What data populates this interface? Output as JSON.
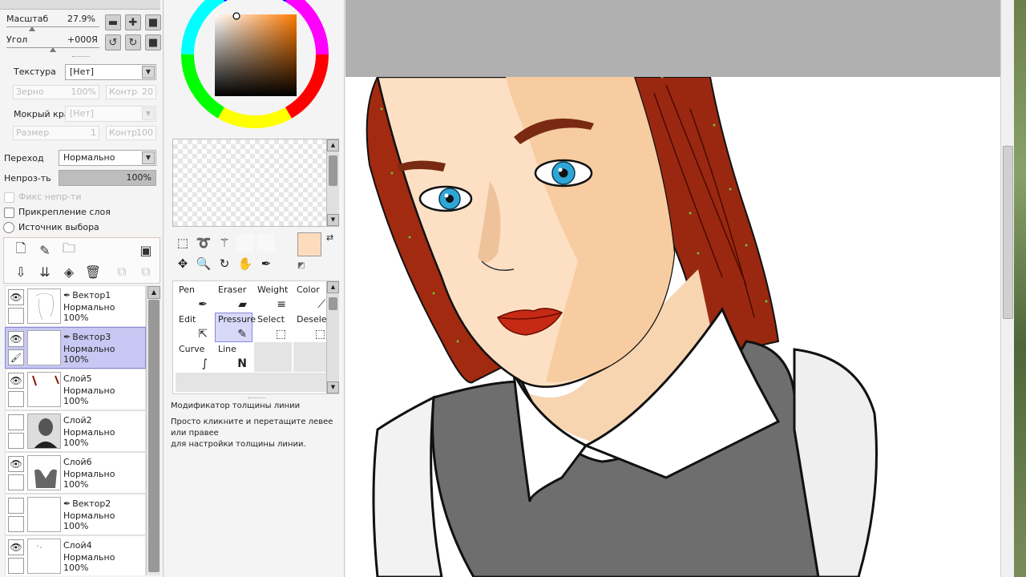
{
  "brush": {
    "zoom_label": "Масштаб",
    "zoom_value": "27.9%",
    "angle_label": "Угол",
    "angle_value": "+000Я",
    "texture_label": "Текстура",
    "texture_value": "[Нет]",
    "grain_label": "Зерно",
    "grain_value": "100%",
    "contrast_label": "Контр",
    "contrast_value": "20",
    "wet_edge_label": "Мокрый край",
    "wet_edge_value": "[Нет]",
    "size_label": "Размер",
    "size_value": "1",
    "contrast2_label": "Контр",
    "contrast2_value": "100"
  },
  "layer_props": {
    "blend_label": "Переход",
    "blend_value": "Нормально",
    "opacity_label": "Непроз-ть",
    "opacity_value": "100%",
    "opacity_level": 1.0,
    "preserve_opacity_label": "Фикс непр-ти",
    "clipping_label": "Прикрепление слоя",
    "selection_source_label": "Источник выбора"
  },
  "layers": [
    {
      "name": "Вектор1",
      "mode": "Нормально",
      "opacity": "100%",
      "vector": true,
      "visible": true,
      "selected": false
    },
    {
      "name": "Вектор3",
      "mode": "Нормально",
      "opacity": "100%",
      "vector": true,
      "visible": true,
      "selected": true
    },
    {
      "name": "Слой5",
      "mode": "Нормально",
      "opacity": "100%",
      "vector": false,
      "visible": true,
      "selected": false
    },
    {
      "name": "Слой2",
      "mode": "Нормально",
      "opacity": "100%",
      "vector": false,
      "visible": false,
      "selected": false
    },
    {
      "name": "Слой6",
      "mode": "Нормально",
      "opacity": "100%",
      "vector": false,
      "visible": true,
      "selected": false
    },
    {
      "name": "Вектор2",
      "mode": "Нормально",
      "opacity": "100%",
      "vector": true,
      "visible": false,
      "selected": false
    },
    {
      "name": "Слой4",
      "mode": "Нормально",
      "opacity": "100%",
      "vector": false,
      "visible": true,
      "selected": false
    }
  ],
  "vector_tools": [
    {
      "label": "Pen",
      "icon": "pen-icon"
    },
    {
      "label": "Eraser",
      "icon": "eraser-icon"
    },
    {
      "label": "Weight",
      "icon": "weight-icon"
    },
    {
      "label": "Color",
      "icon": "color-icon"
    },
    {
      "label": "Edit",
      "icon": "edit-icon"
    },
    {
      "label": "Pressure",
      "icon": "pressure-icon"
    },
    {
      "label": "Select",
      "icon": "select-icon"
    },
    {
      "label": "Deselect",
      "icon": "deselect-icon"
    },
    {
      "label": "Curve",
      "icon": "curve-icon"
    },
    {
      "label": "Line",
      "icon": "line-icon"
    }
  ],
  "selected_tool": "Pressure",
  "tool_help": {
    "title": "Модификатор толщины линии",
    "line1": "Просто кликните и перетащите левее или правее",
    "line2": "для настройки толщины линии."
  },
  "colors": {
    "foreground": "#fddcbd",
    "background": "#ffffff",
    "selection_highlight": "#c8c8f4"
  }
}
